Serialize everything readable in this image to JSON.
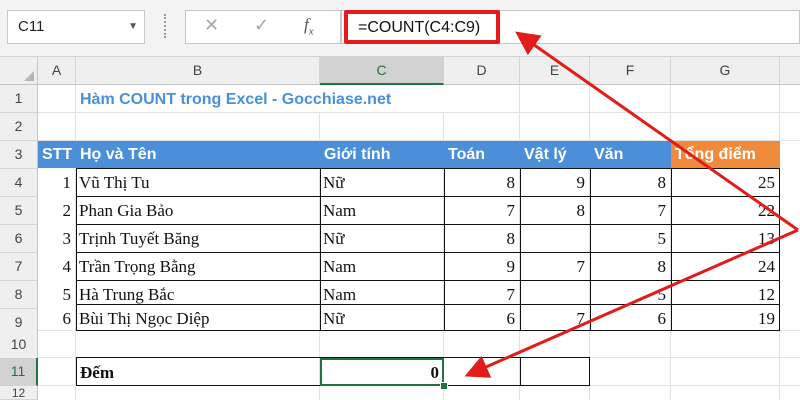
{
  "name_box": {
    "value": "C11",
    "dropdown_icon": "chevron-down-icon"
  },
  "formula_bar": {
    "cancel_icon": "close-icon",
    "enter_icon": "check-icon",
    "fx_label": "fx",
    "formula": "=COUNT(C4:C9)"
  },
  "columns": [
    "A",
    "B",
    "C",
    "D",
    "E",
    "F",
    "G"
  ],
  "rows": [
    "1",
    "2",
    "3",
    "4",
    "5",
    "6",
    "7",
    "8",
    "9",
    "10",
    "11",
    "12"
  ],
  "selected_cell": "C11",
  "title": "Hàm COUNT trong Excel  - Gocchiase.net",
  "headers": {
    "stt": "STT",
    "name": "Họ và Tên",
    "gender": "Giới tính",
    "math": "Toán",
    "physics": "Vật lý",
    "literature": "Văn",
    "total": "Tổng điểm"
  },
  "students": [
    {
      "stt": "1",
      "name": "Vũ Thị Tu",
      "gender": "Nữ",
      "math": "8",
      "physics": "9",
      "literature": "8",
      "total": "25"
    },
    {
      "stt": "2",
      "name": "Phan Gia Bảo",
      "gender": "Nam",
      "math": "7",
      "physics": "8",
      "literature": "7",
      "total": "22"
    },
    {
      "stt": "3",
      "name": "Trịnh Tuyết Băng",
      "gender": "Nữ",
      "math": "8",
      "physics": "",
      "literature": "5",
      "total": "13"
    },
    {
      "stt": "4",
      "name": "Trần Trọng Bằng",
      "gender": "Nam",
      "math": "9",
      "physics": "7",
      "literature": "8",
      "total": "24"
    },
    {
      "stt": "5",
      "name": "Hà Trung Bắc",
      "gender": "Nam",
      "math": "7",
      "physics": "",
      "literature": "5",
      "total": "12"
    },
    {
      "stt": "6",
      "name": "Bùi Thị Ngọc Diệp",
      "gender": "Nữ",
      "math": "6",
      "physics": "7",
      "literature": "6",
      "total": "19"
    }
  ],
  "count_row": {
    "label": "Đếm",
    "value": "0"
  },
  "colors": {
    "header_blue": "#4a8fd8",
    "header_orange": "#f08a3c",
    "title_blue": "#4a90d9",
    "annotation_red": "#e31b1b",
    "selection_green": "#217346"
  }
}
